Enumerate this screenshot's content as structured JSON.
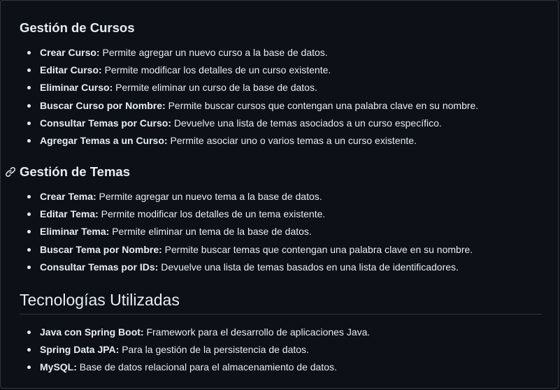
{
  "sections": [
    {
      "heading": "Gestión de Cursos",
      "items": [
        {
          "term": "Crear Curso:",
          "desc": " Permite agregar un nuevo curso a la base de datos."
        },
        {
          "term": "Editar Curso:",
          "desc": " Permite modificar los detalles de un curso existente."
        },
        {
          "term": "Eliminar Curso:",
          "desc": " Permite eliminar un curso de la base de datos."
        },
        {
          "term": "Buscar Curso por Nombre:",
          "desc": " Permite buscar cursos que contengan una palabra clave en su nombre."
        },
        {
          "term": "Consultar Temas por Curso:",
          "desc": " Devuelve una lista de temas asociados a un curso específico."
        },
        {
          "term": "Agregar Temas a un Curso:",
          "desc": " Permite asociar uno o varios temas a un curso existente."
        }
      ]
    },
    {
      "heading": "Gestión de Temas",
      "items": [
        {
          "term": "Crear Tema:",
          "desc": " Permite agregar un nuevo tema a la base de datos."
        },
        {
          "term": "Editar Tema:",
          "desc": " Permite modificar los detalles de un tema existente."
        },
        {
          "term": "Eliminar Tema:",
          "desc": " Permite eliminar un tema de la base de datos."
        },
        {
          "term": "Buscar Tema por Nombre:",
          "desc": " Permite buscar temas que contengan una palabra clave en su nombre."
        },
        {
          "term": "Consultar Temas por IDs:",
          "desc": " Devuelve una lista de temas basados en una lista de identificadores."
        }
      ]
    },
    {
      "heading": "Tecnologías Utilizadas",
      "items": [
        {
          "term": "Java con Spring Boot:",
          "desc": " Framework para el desarrollo de aplicaciones Java."
        },
        {
          "term": "Spring Data JPA:",
          "desc": " Para la gestión de la persistencia de datos."
        },
        {
          "term": "MySQL:",
          "desc": " Base de datos relacional para el almacenamiento de datos."
        }
      ]
    }
  ],
  "icons": {
    "anchor": "link-icon"
  },
  "colors": {
    "background": "#0d1117",
    "text": "#e6edf3",
    "border": "#30363d"
  }
}
